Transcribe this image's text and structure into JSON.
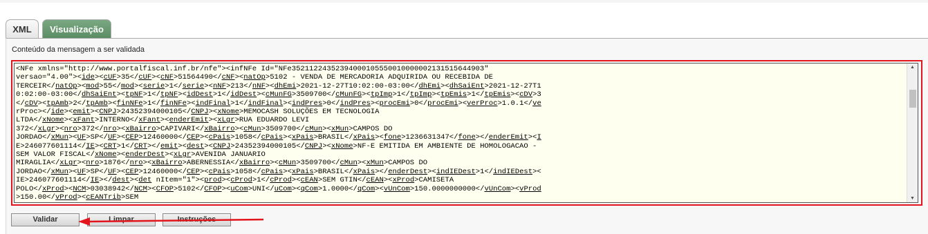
{
  "tabs": [
    {
      "label": "XML"
    },
    {
      "label": "Visualização"
    }
  ],
  "message_label": "Conteúdo da mensagem a ser validada",
  "xml_content": "<NFe xmlns=\"http://www.portalfiscal.inf.br/nfe\"><infNFe Id=\"NFe35211224352394000105550010000002131515644903\" versao=\"4.00\"><ide><cUF>35</cUF><cNF>51564490</cNF><natOp>5102 - VENDA DE MERCADORIA ADQUIRIDA OU RECEBIDA DE TERCEIR</natOp><mod>55</mod><serie>1</serie><nNF>213</nNF><dhEmi>2021-12-27T10:02:00-03:00</dhEmi><dhSaiEnt>2021-12-27T10:02:00-03:00</dhSaiEnt><tpNF>1</tpNF><idDest>1</idDest><cMunFG>3509700</cMunFG><tpImp>1</tpImp><tpEmis>1</tpEmis><cDV>3</cDV><tpAmb>2</tpAmb><finNFe>1</finNFe><indFinal>1</indFinal><indPres>0</indPres><procEmi>0</procEmi><verProc>1.0.1</verProc></ide><emit><CNPJ>24352394000105</CNPJ><xNome>MEMOCASH SOLUÇÕES EM TECNOLOGIA LTDA</xNome><xFant>INTERNO</xFant><enderEmit><xLgr>RUA EDUARDO LEVI 372</xLgr><nro>372</nro><xBairro>CAPIVARI</xBairro><cMun>3509700</cMun><xMun>CAMPOS DO JORDAO</xMun><UF>SP</UF><CEP>12460000</CEP><cPais>1058</cPais><xPais>BRASIL</xPais><fone>1236631347</fone></enderEmit><IE>246077601114</IE><CRT>1</CRT></emit><dest><CNPJ>24352394000105</CNPJ><xNome>NF-E EMITIDA EM AMBIENTE DE HOMOLOGACAO - SEM VALOR FISCAL</xNome><enderDest><xLgr>AVENIDA JANUARIO MIRAGLIA</xLgr><nro>1876</nro><xBairro>ABERNESSIA</xBairro><cMun>3509700</cMun><xMun>CAMPOS DO JORDAO</xMun><UF>SP</UF><CEP>12460000</CEP><cPais>1058</cPais><xPais>BRASIL</xPais></enderDest><indIEDest>1</indIEDest><IE>246077601114</IE></dest><det nItem=\"1\"><prod><cProd>1</cProd><cEAN>SEM GTIN</cEAN><xProd>CAMISETA POLO</xProd><NCM>03038942</NCM><CFOP>5102</CFOP><uCom>UNI</uCom><qCom>1.0000</qCom><vUnCom>150.0000000000</vUnCom><vProd>150.00</vProd><cEANTrib>SEM GTIN</cEANTrib><uTrib>UNI</uTrib><qTrib>1.0000</qTrib><vUnTrib>150.0000000000</vUnTrib><indTot>1</indTot></prod><imposto><vTotTrib>47.18</vTotTrib><ICMS><ICMSSN102><orig>0</orig><CSOSN>102</CSOSN></ICMSSN102></ICMS><PIS><PISOutr><CST>49</CST><vBC>0.00</vBC><pPIS>0.0000</pPIS><vPIS>0.00</vPIS></PISOutr></PIS><COFINS><COFINSOutr><CST>49</CST><vBC>0.00</vBC><pCOFINS>0.0000</pCOFINS><vCOFINS>0.00</vCOFINS></COFINSOutr></COFINS></imposto>",
  "buttons": {
    "validar": "Validar",
    "limpar": "Limpar",
    "instrucoes": "Instruções"
  },
  "colors": {
    "highlight": "#e2141c",
    "active_tab": "#5b8c64",
    "textarea_bg": "#fffff0"
  }
}
